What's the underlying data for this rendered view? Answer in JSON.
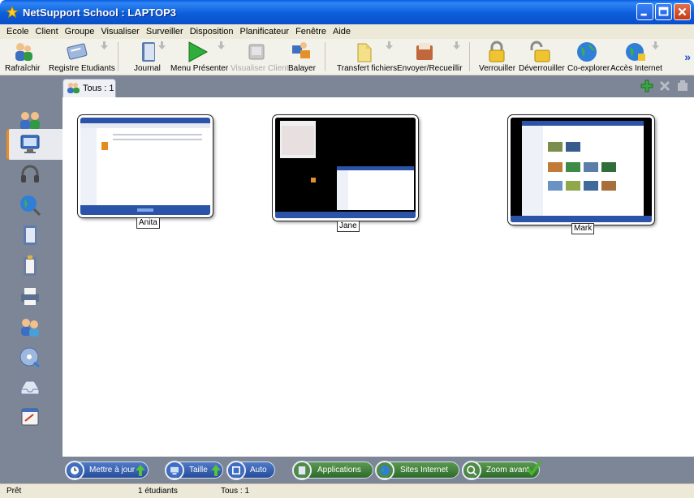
{
  "window": {
    "title": "NetSupport School : LAPTOP3"
  },
  "menu": [
    "Ecole",
    "Client",
    "Groupe",
    "Visualiser",
    "Surveiller",
    "Disposition",
    "Planificateur",
    "Fenêtre",
    "Aide"
  ],
  "toolbar": {
    "refresh": "Rafraîchir",
    "register": "Registre Etudiants",
    "journal": "Journal",
    "present": "Menu Présenter",
    "view_client": "Visualiser Client",
    "scan": "Balayer",
    "file_transfer": "Transfert fichiers",
    "send_collect": "Envoyer/Recueillir",
    "lock": "Verrouiller",
    "unlock": "Déverrouiller",
    "co_browse": "Co-explorer",
    "internet_access": "Accès Internet",
    "more": "»"
  },
  "tab": {
    "label": "Tous : 1"
  },
  "students": [
    {
      "name": "Anita"
    },
    {
      "name": "Jane"
    },
    {
      "name": "Mark"
    }
  ],
  "bottom": {
    "update": "Mettre à jour",
    "size": "Taille",
    "auto": "Auto",
    "applications": "Applications",
    "websites": "Sites Internet",
    "zoom_in": "Zoom avant"
  },
  "status": {
    "state": "Prêt",
    "students_count": "1 étudiants",
    "group": "Tous : 1"
  },
  "colors": {
    "titlebar": "#0d5edb",
    "panel": "#7c8697",
    "menu_bg": "#ece9d8",
    "active_accent": "#f08c1e"
  }
}
